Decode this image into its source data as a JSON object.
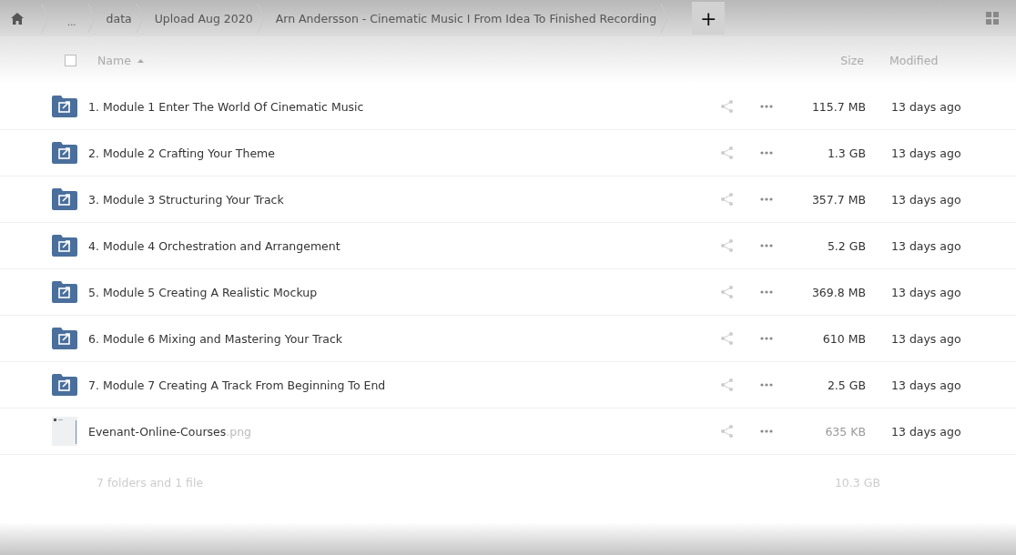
{
  "breadcrumbs": [
    {
      "label": "..."
    },
    {
      "label": "data"
    },
    {
      "label": "Upload Aug 2020"
    },
    {
      "label": "Arn Andersson - Cinematic Music I From Idea To Finished Recording"
    }
  ],
  "new_button": {
    "label": "+"
  },
  "select_all": {
    "checked": false
  },
  "table": {
    "columns": [
      {
        "label": "Name",
        "sorted": true
      },
      {
        "label": "Size",
        "sorted": false
      },
      {
        "label": "Modified",
        "sorted": false
      }
    ],
    "rows": [
      {
        "kind": "folder",
        "name": "1. Module 1 Enter The World Of Cinematic Music",
        "size": "115.7 MB",
        "modified": "13 days ago"
      },
      {
        "kind": "folder",
        "name": "2. Module 2 Crafting Your Theme",
        "size": "1.3 GB",
        "modified": "13 days ago"
      },
      {
        "kind": "folder",
        "name": "3. Module 3 Structuring Your Track",
        "size": "357.7 MB",
        "modified": "13 days ago"
      },
      {
        "kind": "folder",
        "name": "4. Module 4 Orchestration and Arrangement",
        "size": "5.2 GB",
        "modified": "13 days ago"
      },
      {
        "kind": "folder",
        "name": "5. Module 5 Creating A Realistic Mockup",
        "size": "369.8 MB",
        "modified": "13 days ago"
      },
      {
        "kind": "folder",
        "name": "6. Module 6 Mixing and Mastering Your Track",
        "size": "610 MB",
        "modified": "13 days ago"
      },
      {
        "kind": "folder",
        "name": "7. Module 7 Creating A Track From Beginning To End",
        "size": "2.5 GB",
        "modified": "13 days ago"
      },
      {
        "kind": "file",
        "name": "Evenant-Online-Courses",
        "extension": ".png",
        "size": "635 KB",
        "modified": "13 days ago"
      }
    ],
    "summary": {
      "count": "7 folders and 1 file",
      "size": "10.3 GB"
    }
  }
}
